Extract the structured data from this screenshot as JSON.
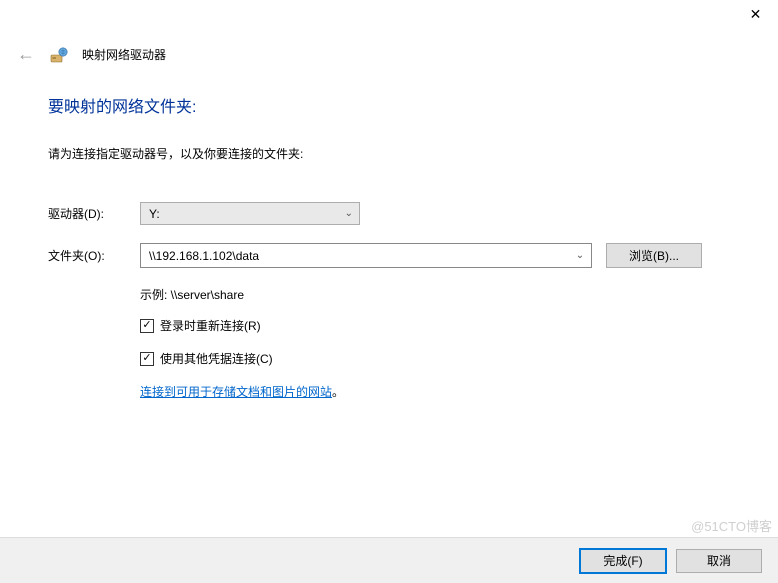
{
  "titlebar": {
    "close_glyph": "✕"
  },
  "header": {
    "back_glyph": "←",
    "window_title": "映射网络驱动器"
  },
  "main": {
    "heading": "要映射的网络文件夹:",
    "instruction": "请为连接指定驱动器号，以及你要连接的文件夹:",
    "drive_label": "驱动器(D):",
    "drive_value": "Y:",
    "folder_label": "文件夹(O):",
    "folder_value": "\\\\192.168.1.102\\data",
    "browse_label": "浏览(B)...",
    "example_text": "示例: \\\\server\\share",
    "reconnect_label": "登录时重新连接(R)",
    "reconnect_checked": "✓",
    "credentials_label": "使用其他凭据连接(C)",
    "credentials_checked": "✓",
    "link_prefix": "连接到可用于存储文档和图片的网站",
    "link_suffix": "。"
  },
  "footer": {
    "finish_label": "完成(F)",
    "cancel_label": "取消"
  },
  "watermark": "@51CTO博客"
}
